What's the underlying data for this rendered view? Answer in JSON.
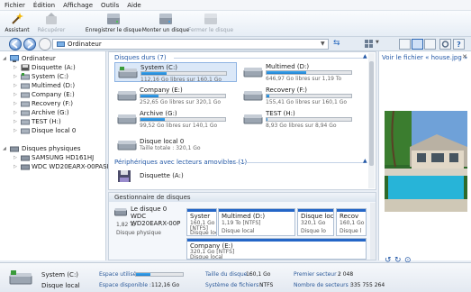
{
  "menu": {
    "items": [
      "Fichier",
      "Édition",
      "Affichage",
      "Outils",
      "Aide"
    ]
  },
  "toolbar": {
    "assistant": "Assistant",
    "recover": "Récupérer",
    "save_disk": "Enregistrer le disque",
    "mount_disk": "Monter un disque",
    "close_disk": "Fermer le disque"
  },
  "address": {
    "value": "Ordinateur"
  },
  "tree": {
    "root": "Ordinateur",
    "items": [
      "Disquette (A:)",
      "System (C:)",
      "Multimed (D:)",
      "Company (E:)",
      "Recovery (F:)",
      "Archive (G:)",
      "TEST (H:)",
      "Disque local 0"
    ],
    "physical_root": "Disques physiques",
    "physical": [
      "SAMSUNG HD161HJ",
      "WDC WD20EARX-00PASB0"
    ]
  },
  "main": {
    "hdd_section": "Disques durs (7)",
    "removable_section": "Périphériques avec lecteurs amovibles (1)",
    "drives": [
      {
        "name": "System (C:)",
        "free": "112,16 Go libres sur 160,1 Go",
        "used_fraction": 0.3
      },
      {
        "name": "Multimed (D:)",
        "free": "646,97 Go libres sur 1,19 To",
        "used_fraction": 0.47
      },
      {
        "name": "Company (E:)",
        "free": "252,65 Go libres sur 320,1 Go",
        "used_fraction": 0.21
      },
      {
        "name": "Recovery (F:)",
        "free": "155,41 Go libres sur 160,1 Go",
        "used_fraction": 0.03
      },
      {
        "name": "Archive (G:)",
        "free": "99,52 Go libres sur 140,1 Go",
        "used_fraction": 0.29
      },
      {
        "name": "TEST (H:)",
        "free": "8,93 Go libres sur 8,94 Go",
        "used_fraction": 0.01
      },
      {
        "name": "Disque local 0",
        "free": "Taille totale : 320,1 Go",
        "used_fraction": null
      }
    ],
    "removable": [
      {
        "name": "Disquette (A:)"
      }
    ]
  },
  "disk_manager": {
    "title": "Gestionnaire de disques",
    "disk": {
      "name": "Le disque 0",
      "model": "WDC WD20EARX-00P",
      "size": "1,82 To",
      "type": "Disque physique"
    },
    "partitions": [
      {
        "name": "Syster",
        "size": "160,1 Go",
        "fs": "[NTFS]",
        "type": "Disque loc"
      },
      {
        "name": "Multimed (D:)",
        "size": "1,19 To [NTFS]",
        "type": "Disque local"
      },
      {
        "name": "Disque loc",
        "size": "320,1 Go",
        "type": "Disque lo"
      },
      {
        "name": "Recov",
        "size": "160,1 Go",
        "type": "Disque l"
      },
      {
        "name": "Company (E:)",
        "size": "320,1 Go [NTFS]",
        "type": "Disque local"
      }
    ]
  },
  "preview": {
    "title": "Voir le fichier « house.jpg »"
  },
  "status": {
    "name": "System (C:)",
    "type": "Disque local",
    "used_label": "Espace utilisé :",
    "used_fraction": 0.3,
    "free_label": "Espace disponible :",
    "free_value": "112,16 Go",
    "size_label": "Taille du disque :",
    "size_value": "160,1 Go",
    "fs_label": "Système de fichiers :",
    "fs_value": "NTFS",
    "first_sector_label": "Premier secteur :",
    "first_sector_value": "2 048",
    "sector_count_label": "Nombre de secteurs :",
    "sector_count_value": "335 755 264"
  },
  "colors": {
    "accent": "#2466c7",
    "bar_fill": "#2a8fe0",
    "section_header": "#2358a6"
  }
}
